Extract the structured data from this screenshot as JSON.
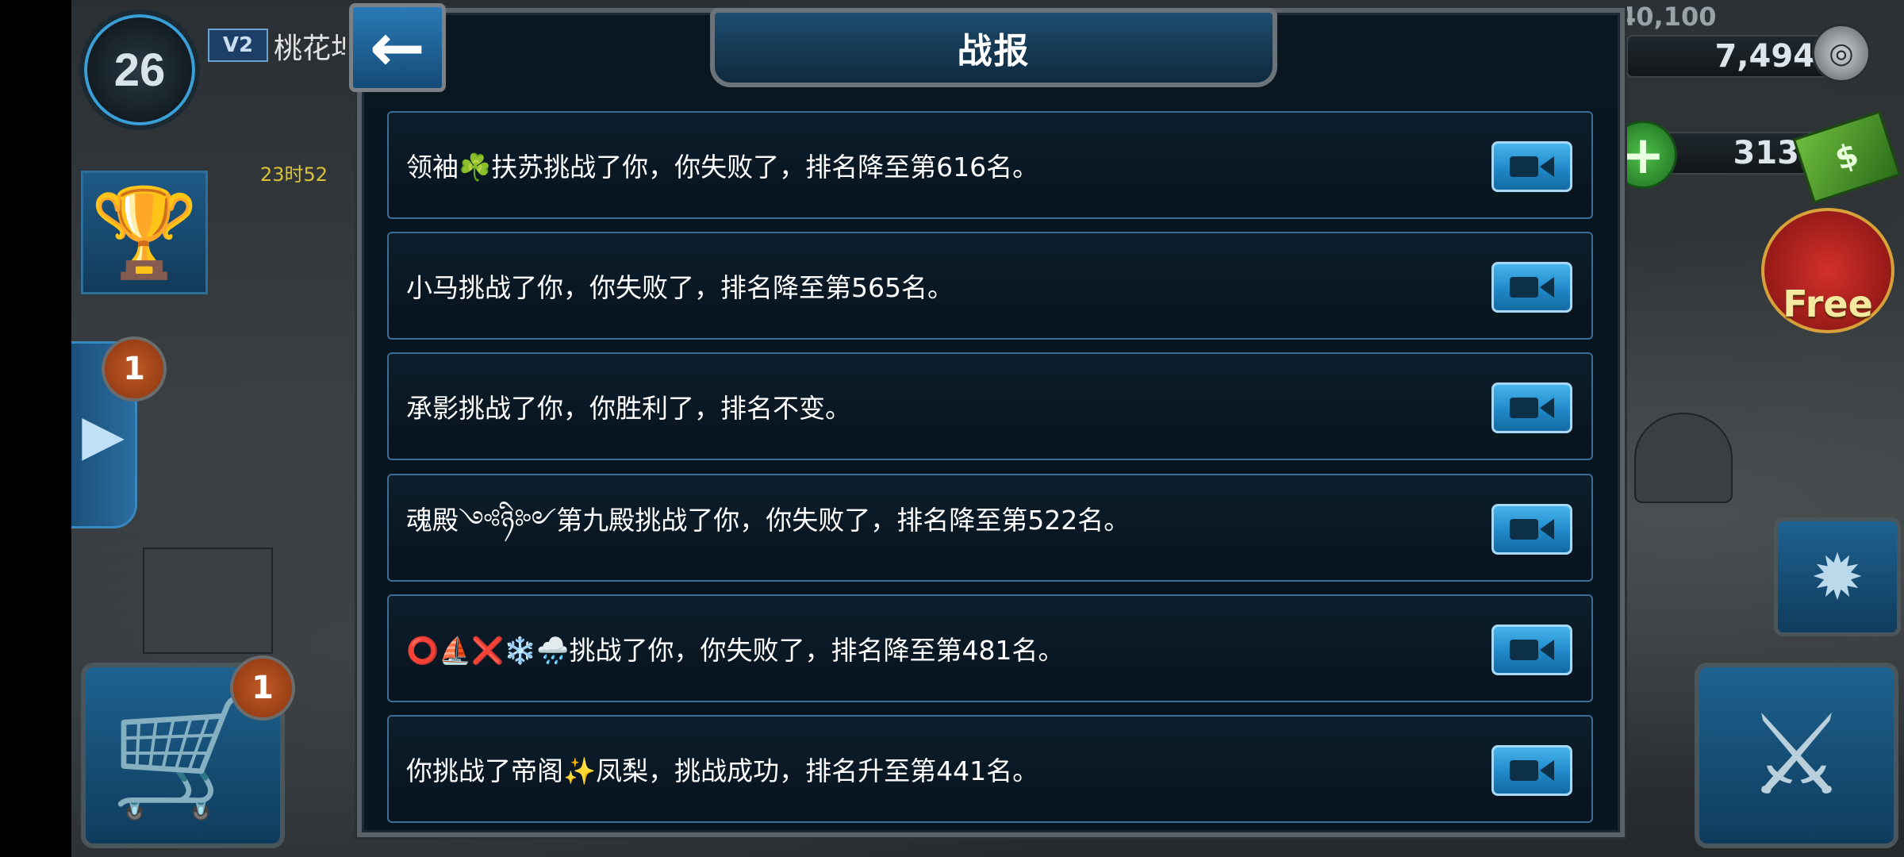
{
  "hud": {
    "level": "26",
    "vip": "V2",
    "player_name": "桃花坞",
    "timer": "23时52",
    "gold_total": "40,100",
    "silver": "7,494",
    "cash": "313",
    "gift_label": "Free",
    "side_badge": "1",
    "cart_badge": "1"
  },
  "dialog": {
    "title": "战报",
    "back_icon": "←"
  },
  "reports": [
    {
      "text": "领袖☘️扶苏挑战了你，你失败了，排名降至第616名。",
      "action": "replay"
    },
    {
      "text": "小马挑战了你，你失败了，排名降至第565名。",
      "action": "replay"
    },
    {
      "text": "承影挑战了你，你胜利了，排名不变。",
      "action": "replay"
    },
    {
      "text": "魂殿༺ཉི༻第九殿挑战了你，你失败了，排名降至第522名。",
      "action": "replay"
    },
    {
      "text": "⭕⛵❌❄️🌧️挑战了你，你失败了，排名降至第481名。",
      "action": "replay"
    },
    {
      "text": "你挑战了帝阁✨凤梨，挑战成功，排名升至第441名。",
      "action": "replay"
    }
  ],
  "icons": {
    "trophy": "trophy-icon",
    "cart": "cart-icon",
    "replay": "video-camera-icon",
    "coin": "coin-icon",
    "cash": "cash-icon",
    "battle": "crossed-guns-icon"
  }
}
